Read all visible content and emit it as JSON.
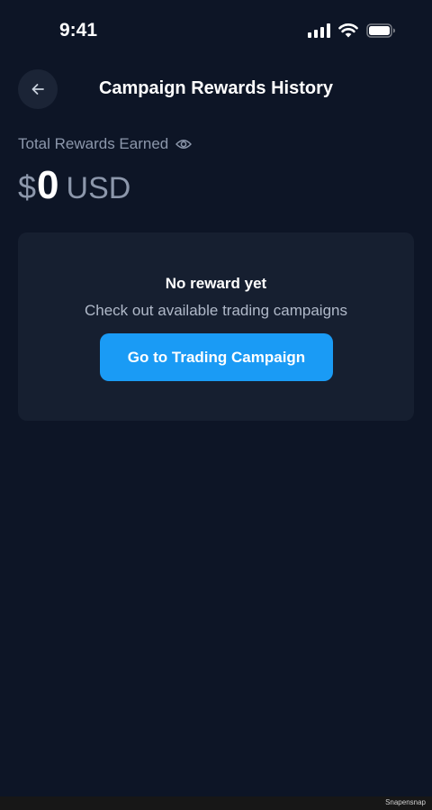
{
  "status_bar": {
    "time": "9:41",
    "icons": [
      "signal-icon",
      "wifi-icon",
      "battery-icon"
    ]
  },
  "header": {
    "title": "Campaign Rewards History",
    "back_icon": "arrow-left-icon"
  },
  "rewards": {
    "label": "Total Rewards Earned",
    "visibility_icon": "eye-icon",
    "currency_symbol": "$",
    "amount": "0",
    "currency_code": "USD"
  },
  "empty_state": {
    "title": "No reward yet",
    "subtitle": "Check out available trading campaigns",
    "button_label": "Go to Trading Campaign"
  },
  "footer": {
    "watermark": "Snapensnap"
  },
  "colors": {
    "background": "#0d1526",
    "card": "#161f30",
    "accent": "#1a9bf5",
    "muted_text": "#8c97ab"
  }
}
